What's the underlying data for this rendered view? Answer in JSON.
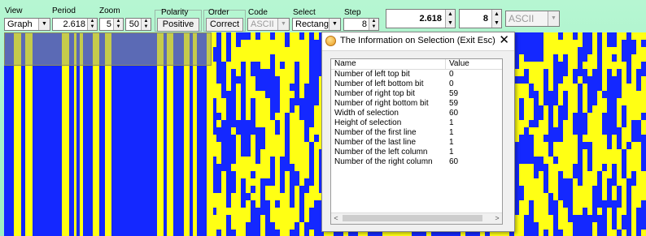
{
  "toolbar": {
    "view": {
      "label": "View",
      "value": "Graph"
    },
    "period": {
      "label": "Period",
      "value": "2.618"
    },
    "zoom": {
      "label": "Zoom",
      "value1": "5",
      "value2": "50"
    },
    "polarity": {
      "label": "Polarity",
      "value": "Positive"
    },
    "order": {
      "label": "Order",
      "value": "Correct"
    },
    "code": {
      "label": "Code",
      "value": "ASCII"
    },
    "select": {
      "label": "Select",
      "value": "Rectangle"
    },
    "step": {
      "label": "Step",
      "value": "8"
    },
    "period_big": {
      "value": "2.618"
    },
    "step_big": {
      "value": "8"
    },
    "code_big": {
      "value": "ASCII"
    }
  },
  "visualization": {
    "colors": {
      "one": "#ffff14",
      "zero": "#1428ff",
      "selection": "#b0b070"
    }
  },
  "dialog": {
    "title": "The Information on Selection (Exit   Esc)",
    "close_icon": "close-icon",
    "columns": {
      "name": "Name",
      "value": "Value"
    },
    "rows": [
      {
        "name": "Number of left top bit",
        "value": "0"
      },
      {
        "name": "Number of left bottom bit",
        "value": "0"
      },
      {
        "name": "Number of right top bit",
        "value": "59"
      },
      {
        "name": "Number of right bottom bit",
        "value": "59"
      },
      {
        "name": "Width of selection",
        "value": "60"
      },
      {
        "name": "Height of selection",
        "value": "1"
      },
      {
        "name": "Number of the first line",
        "value": "1"
      },
      {
        "name": "Number of the last line",
        "value": "1"
      },
      {
        "name": "Number of the left column",
        "value": "1"
      },
      {
        "name": "Number of the right column",
        "value": "60"
      }
    ]
  }
}
